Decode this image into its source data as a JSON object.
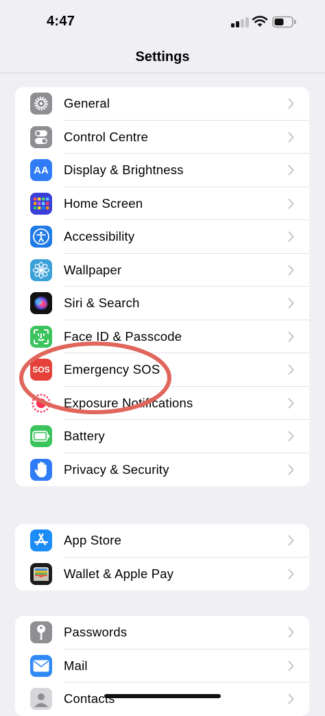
{
  "status_bar": {
    "time": "4:47"
  },
  "nav": {
    "title": "Settings"
  },
  "groups": [
    {
      "items": [
        {
          "label": "General",
          "icon": "gear-icon",
          "color": "#8e8e93"
        },
        {
          "label": "Control Centre",
          "icon": "toggles-icon",
          "color": "#8e8e93"
        },
        {
          "label": "Display & Brightness",
          "icon": "text-size-icon",
          "color": "#2f7cf6",
          "glyph": "AA"
        },
        {
          "label": "Home Screen",
          "icon": "app-grid-icon",
          "color": "#3a3fd9"
        },
        {
          "label": "Accessibility",
          "icon": "accessibility-icon",
          "color": "#1f7ae6"
        },
        {
          "label": "Wallpaper",
          "icon": "flower-icon",
          "color": "#3aa0d8"
        },
        {
          "label": "Siri & Search",
          "icon": "siri-icon",
          "color": "#1a1a2e"
        },
        {
          "label": "Face ID & Passcode",
          "icon": "face-id-icon",
          "color": "#3bc45c"
        },
        {
          "label": "Emergency SOS",
          "icon": "sos-icon",
          "color": "#e5413a",
          "glyph": "SOS"
        },
        {
          "label": "Exposure Notifications",
          "icon": "exposure-icon",
          "color": "#ffffff"
        },
        {
          "label": "Battery",
          "icon": "battery-icon",
          "color": "#3bc45c"
        },
        {
          "label": "Privacy & Security",
          "icon": "hand-icon",
          "color": "#2f7cf6"
        }
      ]
    },
    {
      "items": [
        {
          "label": "App Store",
          "icon": "app-store-icon",
          "color": "#1c8cf6"
        },
        {
          "label": "Wallet & Apple Pay",
          "icon": "wallet-icon",
          "color": "#1c1c1e"
        }
      ]
    },
    {
      "items": [
        {
          "label": "Passwords",
          "icon": "key-icon",
          "color": "#8e8e93"
        },
        {
          "label": "Mail",
          "icon": "mail-icon",
          "color": "#2f8af5"
        },
        {
          "label": "Contacts",
          "icon": "contacts-icon",
          "color": "#c9c9ce"
        }
      ]
    }
  ],
  "annotation": {
    "color": "#e0665c",
    "target": "Emergency SOS"
  }
}
